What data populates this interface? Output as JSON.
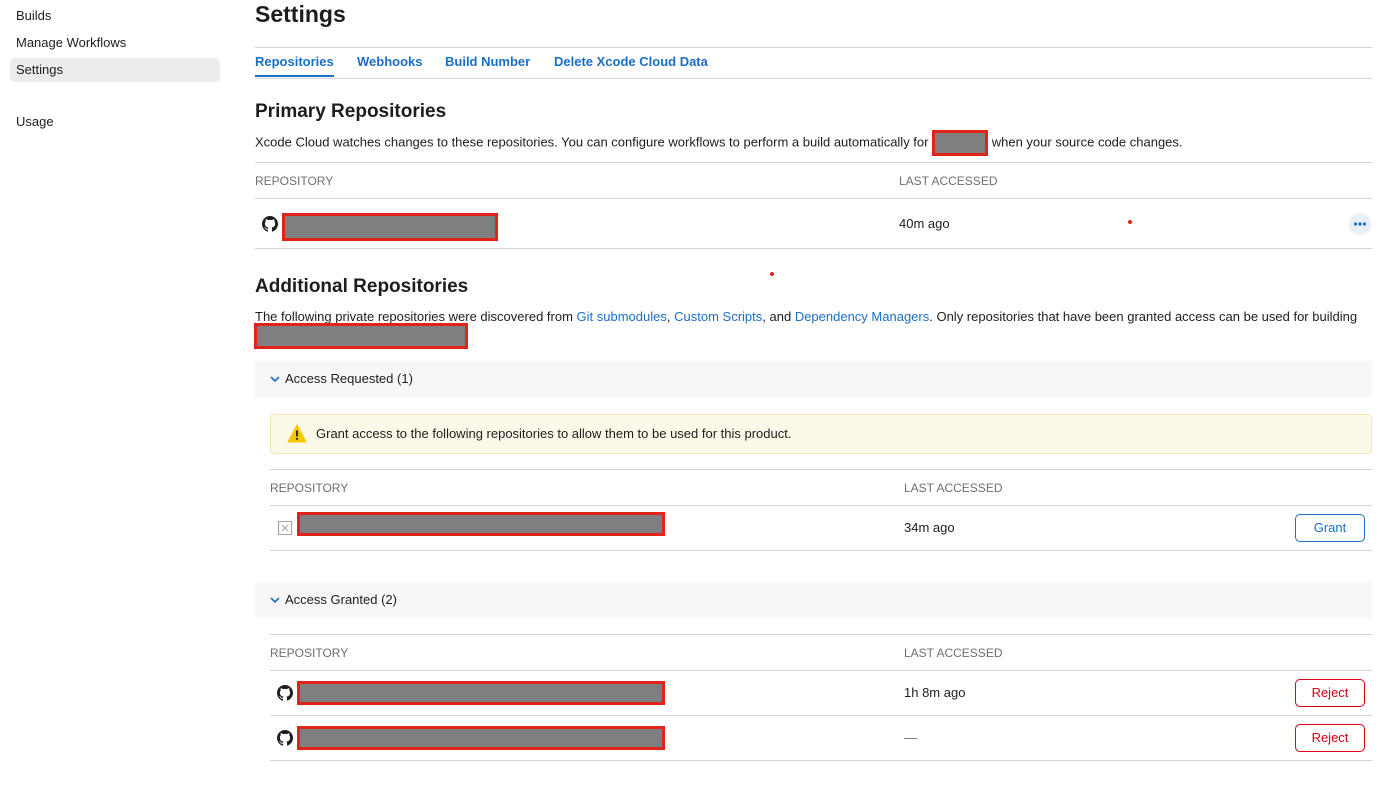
{
  "sidebar": {
    "items": [
      {
        "label": "Builds"
      },
      {
        "label": "Manage Workflows"
      },
      {
        "label": "Settings"
      },
      {
        "label": "Usage"
      }
    ]
  },
  "page": {
    "title": "Settings"
  },
  "tabs": [
    {
      "label": "Repositories"
    },
    {
      "label": "Webhooks"
    },
    {
      "label": "Build Number"
    },
    {
      "label": "Delete Xcode Cloud Data"
    }
  ],
  "primary": {
    "heading": "Primary Repositories",
    "desc_before": "Xcode Cloud watches changes to these repositories. You can configure workflows to perform a build automatically for",
    "desc_after": "when your source code changes.",
    "col_repository": "REPOSITORY",
    "col_last_accessed": "LAST ACCESSED",
    "rows": [
      {
        "last_accessed": "40m ago"
      }
    ]
  },
  "additional": {
    "heading": "Additional Repositories",
    "desc_part1": "The following private repositories were discovered from",
    "link_git": "Git submodules",
    "sep1": ",",
    "link_scripts": "Custom Scripts",
    "sep2": ", and",
    "link_deps": "Dependency Managers",
    "desc_part2": ". Only repositories that have been granted access can be used for building",
    "requested": {
      "label": "Access Requested (1)",
      "warning": "Grant access to the following repositories to allow them to be used for this product.",
      "col_repository": "REPOSITORY",
      "col_last_accessed": "LAST ACCESSED",
      "rows": [
        {
          "last_accessed": "34m ago",
          "action": "Grant"
        }
      ]
    },
    "granted": {
      "label": "Access Granted (2)",
      "col_repository": "REPOSITORY",
      "col_last_accessed": "LAST ACCESSED",
      "rows": [
        {
          "last_accessed": "1h 8m ago",
          "action": "Reject"
        },
        {
          "last_accessed": "—",
          "action": "Reject"
        }
      ]
    }
  },
  "icons": {
    "github": "github-icon",
    "warning": "warning-icon",
    "broken_image": "broken-image-icon",
    "more": "more-icon",
    "chevron": "chevron-down-icon"
  },
  "colors": {
    "link": "#1a6fc7",
    "reject": "#d70015",
    "redaction_outline": "#e2231a",
    "warning_bg": "#fdf9e9"
  }
}
